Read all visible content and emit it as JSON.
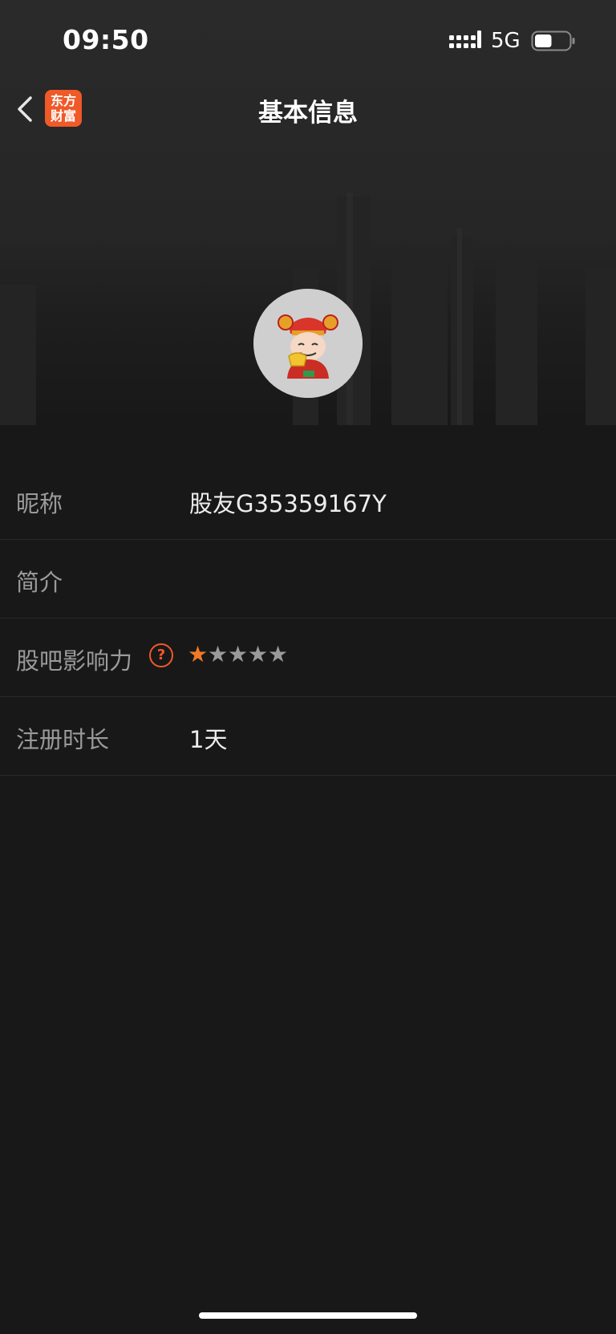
{
  "status_bar": {
    "time": "09:50",
    "network": "5G",
    "battery_level": 0.5
  },
  "nav": {
    "title": "基本信息",
    "logo_line1": "东方",
    "logo_line2": "财富",
    "back_icon": "chevron-left-icon"
  },
  "colors": {
    "background": "#181818",
    "accent": "#ef5a28",
    "star_on": "#ef7a28",
    "label": "#9a9a9a",
    "value": "#ededed"
  },
  "profile": {
    "avatar_icon": "caishen-avatar-icon",
    "rows": [
      {
        "label": "昵称",
        "value": "股友G35359167Y"
      },
      {
        "label": "简介",
        "value": ""
      },
      {
        "label": "股吧影响力",
        "help_icon": "question-circle-icon",
        "rating": 1,
        "rating_max": 5
      },
      {
        "label": "注册时长",
        "value": "1天"
      }
    ]
  }
}
